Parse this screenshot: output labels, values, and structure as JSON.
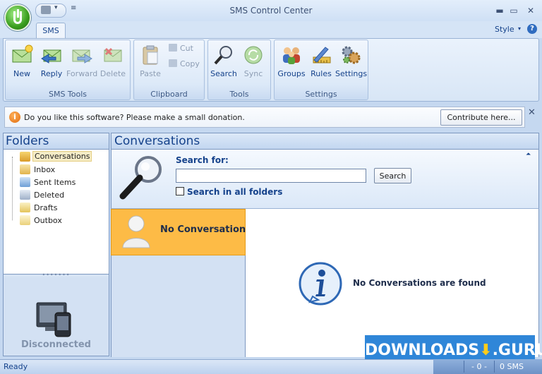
{
  "window": {
    "title": "SMS Control Center"
  },
  "title_controls": {
    "minimize": "▬",
    "maximize": "▭",
    "close": "✕"
  },
  "qat": {
    "dropdown": "▾",
    "more": "≡"
  },
  "ribbon": {
    "tabs": [
      {
        "label": "SMS"
      }
    ],
    "style_label": "Style",
    "style_dropdown": "▾",
    "help": "?",
    "groups": {
      "sms_tools": {
        "label": "SMS Tools",
        "buttons": [
          {
            "label": "New",
            "icon": "new-sms-icon"
          },
          {
            "label": "Reply",
            "icon": "reply-icon"
          },
          {
            "label": "Forward",
            "icon": "forward-icon"
          },
          {
            "label": "Delete",
            "icon": "delete-icon"
          }
        ]
      },
      "clipboard": {
        "label": "Clipboard",
        "paste": "Paste",
        "cut": "Cut",
        "copy": "Copy"
      },
      "tools": {
        "label": "Tools",
        "buttons": [
          {
            "label": "Search"
          },
          {
            "label": "Sync"
          }
        ]
      },
      "settings": {
        "label": "Settings",
        "buttons": [
          {
            "label": "Groups"
          },
          {
            "label": "Rules"
          },
          {
            "label": "Settings"
          }
        ]
      }
    }
  },
  "infobar": {
    "icon": "i",
    "text": "Do you like this software? Please make a small donation.",
    "button": "Contribute here...",
    "close": "✕"
  },
  "folders": {
    "title": "Folders",
    "items": [
      {
        "label": "Conversations",
        "icon": "conversations-icon",
        "selected": true
      },
      {
        "label": "Inbox",
        "icon": "inbox-icon"
      },
      {
        "label": "Sent Items",
        "icon": "sent-items-icon"
      },
      {
        "label": "Deleted",
        "icon": "deleted-icon"
      },
      {
        "label": "Drafts",
        "icon": "drafts-icon"
      },
      {
        "label": "Outbox",
        "icon": "outbox-icon"
      }
    ],
    "splitter_dots": "•••••••",
    "device_status": "Disconnected"
  },
  "conversations": {
    "title": "Conversations",
    "collapse": "⏶",
    "search": {
      "label": "Search for:",
      "value": "",
      "button": "Search",
      "all_folders_label": "Search in all folders"
    },
    "list_item": "No Conversation",
    "empty_message": "No Conversations are found"
  },
  "watermark": {
    "text_left": "DOWNLOADS",
    "text_mid": "⬇",
    "text_right": ".GURU"
  },
  "status": {
    "text": "Ready",
    "count": "- 0 -",
    "sms": "0 SMS"
  },
  "colors": {
    "accent": "#15428b",
    "selected_conversation": "#fdbb46",
    "watermark": "#2f86d8"
  }
}
